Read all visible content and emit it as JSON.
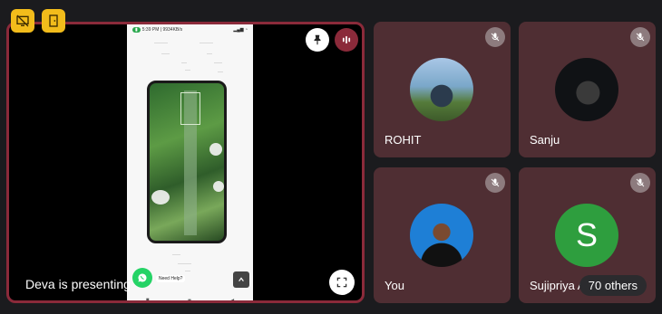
{
  "top_icons": [
    {
      "icon": "screen-share-off-icon"
    },
    {
      "icon": "exit-door-icon"
    }
  ],
  "presenter": {
    "label": "Deva is presenting",
    "accent_color": "#8b2a3a",
    "shared_screen": {
      "status_time": "5:39 PM | 9934KB/s",
      "chat_prompt": "Need Help?"
    }
  },
  "participants": [
    {
      "name": "ROHIT",
      "avatar": "photo",
      "muted": true
    },
    {
      "name": "Sanju",
      "avatar": "photo",
      "muted": true
    },
    {
      "name": "You",
      "avatar": "photo",
      "muted": true
    },
    {
      "name": "Sujipriya A",
      "avatar_letter": "S",
      "avatar_color": "#2e9e3e",
      "muted": true
    }
  ],
  "others_count_label": "70 others",
  "tile_color": "#4f2e33"
}
